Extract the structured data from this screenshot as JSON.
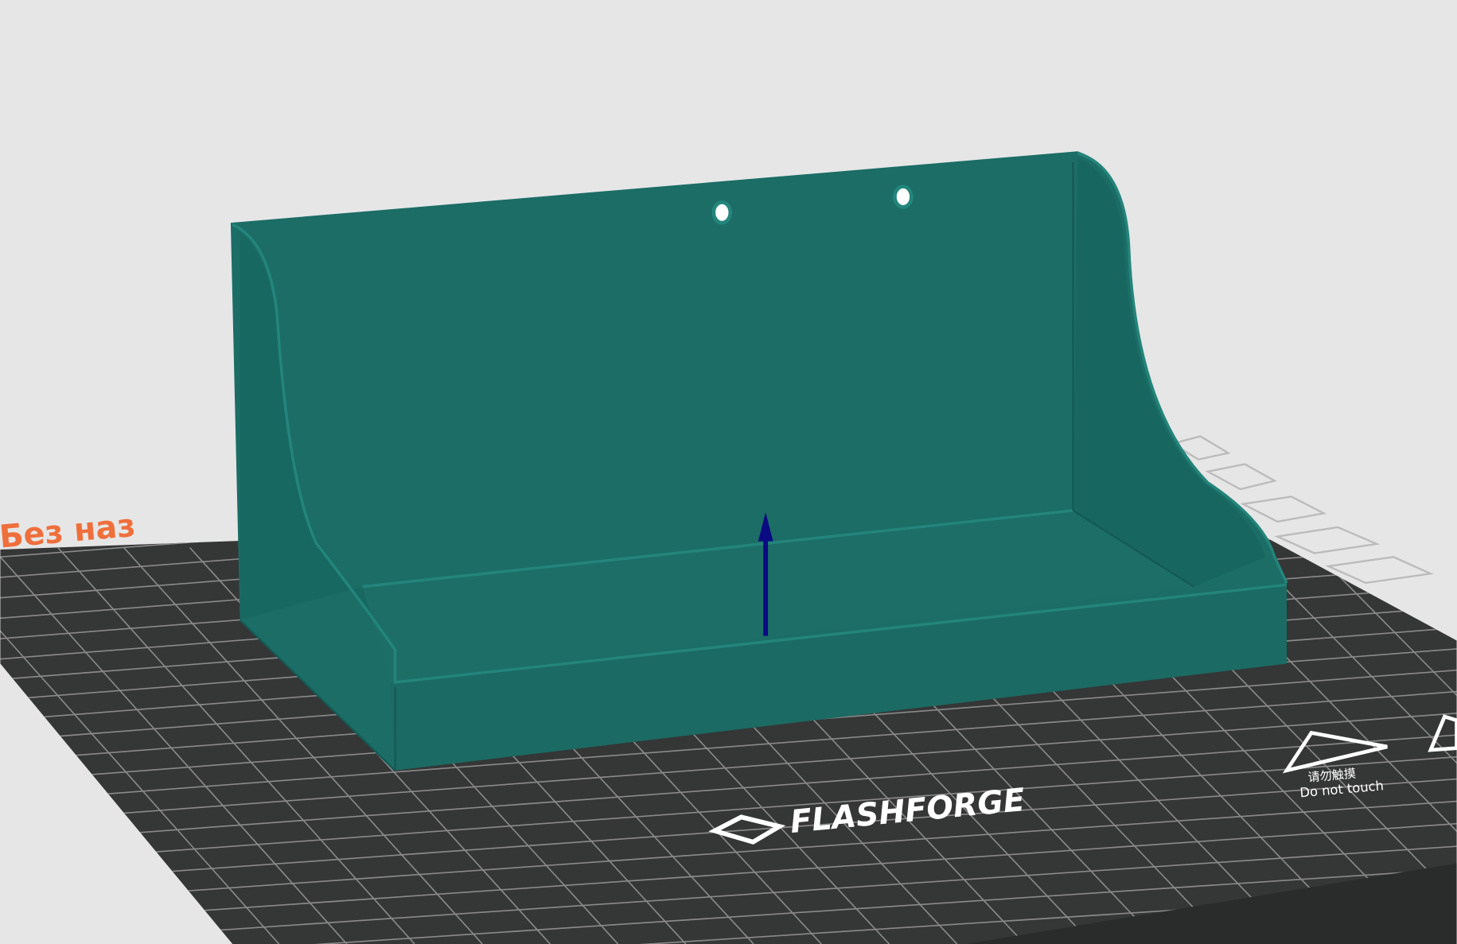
{
  "viewport": {
    "plate_label": "Без наз",
    "brand_logo": "FLASHFORGE",
    "warning_cn": "请勿触摸",
    "warning_en": "Do not touch",
    "colors": {
      "background": "#e6e6e6",
      "bed": "#353636",
      "grid": "#8a8a8a",
      "model": "#1b6d66",
      "model_dark": "#165f59",
      "model_edge": "#23857b",
      "label": "#ef6f3c",
      "arrow": "#0a0a82"
    }
  }
}
